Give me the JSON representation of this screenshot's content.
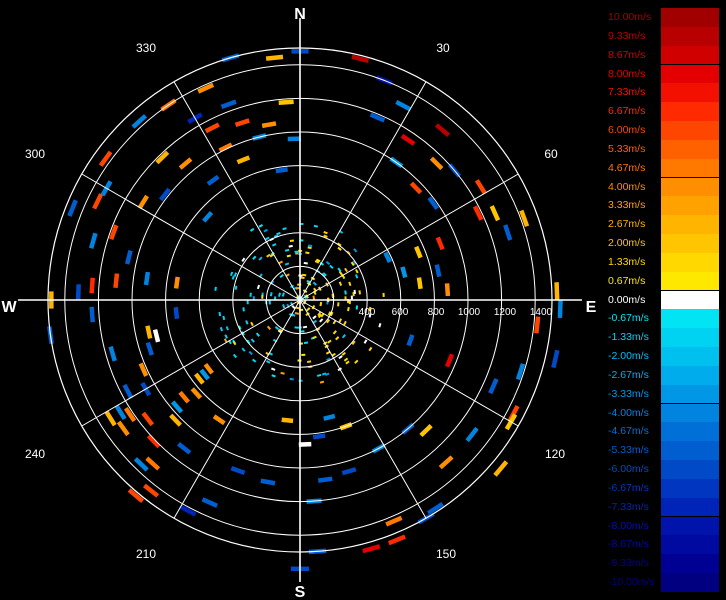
{
  "chart_data": {
    "type": "polar-scatter",
    "title": "",
    "directions": {
      "north": "N",
      "east": "E",
      "south": "S",
      "west": "W"
    },
    "angle_labels": [
      "30",
      "60",
      "120",
      "150",
      "210",
      "240",
      "300",
      "330"
    ],
    "range_labels": [
      "400",
      "600",
      "800",
      "1000",
      "1200",
      "1400"
    ],
    "range_max": 1500,
    "ring_step": 200,
    "legend": {
      "labels": [
        "10.00m/s",
        "9.33m/s",
        "8.67m/s",
        "8.00m/s",
        "7.33m/s",
        "6.67m/s",
        "6.00m/s",
        "5.33m/s",
        "4.67m/s",
        "4.00m/s",
        "3.33m/s",
        "2.67m/s",
        "2.00m/s",
        "1.33m/s",
        "0.67m/s",
        "0.00m/s",
        "-0.67m/s",
        "-1.33m/s",
        "-2.00m/s",
        "-2.67m/s",
        "-3.33m/s",
        "-4.00m/s",
        "-4.67m/s",
        "-5.33m/s",
        "-6.00m/s",
        "-6.67m/s",
        "-7.33m/s",
        "-8.00m/s",
        "-8.67m/s",
        "-9.33m/s",
        "-10.00m/s"
      ],
      "colors": [
        "#a00000",
        "#b80000",
        "#d00000",
        "#e40000",
        "#f41000",
        "#ff2a00",
        "#ff4600",
        "#ff6000",
        "#ff7800",
        "#ff8e00",
        "#ffa200",
        "#ffb400",
        "#ffc600",
        "#ffd800",
        "#ffe800",
        "#ffffff",
        "#00e4f4",
        "#00d2f2",
        "#00c0f0",
        "#00acec",
        "#0098e6",
        "#0084e0",
        "#0070d8",
        "#005ed0",
        "#004ac8",
        "#0036c0",
        "#0024b8",
        "#0014ac",
        "#000aa0",
        "#000092",
        "#000080"
      ]
    },
    "points": [
      {
        "az": 0,
        "r": 1480,
        "v": -6.0
      },
      {
        "az": 14,
        "r": 1480,
        "v": 9.0
      },
      {
        "az": 21,
        "r": 1400,
        "v": -8.0
      },
      {
        "az": 23,
        "r": 1180,
        "v": -5.0
      },
      {
        "az": 28,
        "r": 1310,
        "v": -4.0
      },
      {
        "az": 34,
        "r": 1150,
        "v": 8.0
      },
      {
        "az": 40,
        "r": 1320,
        "v": 9.0
      },
      {
        "az": 45,
        "r": 1150,
        "v": 4.0
      },
      {
        "az": 46,
        "r": 960,
        "v": 6.0
      },
      {
        "az": 50,
        "r": 1200,
        "v": -6.0
      },
      {
        "az": 35,
        "r": 1000,
        "v": -3.0
      },
      {
        "az": 58,
        "r": 1270,
        "v": 6.0
      },
      {
        "az": 54,
        "r": 980,
        "v": -5.0
      },
      {
        "az": 64,
        "r": 1180,
        "v": 7.0
      },
      {
        "az": 66,
        "r": 1270,
        "v": 2.0
      },
      {
        "az": 70,
        "r": 1420,
        "v": 2.5
      },
      {
        "az": 72,
        "r": 1300,
        "v": -5.0
      },
      {
        "az": 68,
        "r": 900,
        "v": 7.0
      },
      {
        "az": 68,
        "r": 760,
        "v": 2.0
      },
      {
        "az": 75,
        "r": 640,
        "v": -3.0
      },
      {
        "az": 64,
        "r": 580,
        "v": -4.0
      },
      {
        "az": 78,
        "r": 840,
        "v": -5.0
      },
      {
        "az": 82,
        "r": 720,
        "v": 2.0
      },
      {
        "az": 86,
        "r": 880,
        "v": 4.0
      },
      {
        "az": 88,
        "r": 1530,
        "v": 2.5
      },
      {
        "az": 92,
        "r": 1550,
        "v": -4.0
      },
      {
        "az": 96,
        "r": 1420,
        "v": 6.0
      },
      {
        "az": 103,
        "r": 1560,
        "v": -6.0
      },
      {
        "az": 108,
        "r": 1380,
        "v": -4.0
      },
      {
        "az": 114,
        "r": 1260,
        "v": -5.0
      },
      {
        "az": 118,
        "r": 1440,
        "v": 6.0
      },
      {
        "az": 112,
        "r": 960,
        "v": 8.0
      },
      {
        "az": 110,
        "r": 700,
        "v": -5.0
      },
      {
        "az": 120,
        "r": 1450,
        "v": 2.0
      },
      {
        "az": 130,
        "r": 1560,
        "v": 3.0
      },
      {
        "az": 128,
        "r": 1300,
        "v": -4.0
      },
      {
        "az": 136,
        "r": 1080,
        "v": 2.0
      },
      {
        "az": 138,
        "r": 1300,
        "v": 4.0
      },
      {
        "az": 147,
        "r": 1480,
        "v": -5.0
      },
      {
        "az": 150,
        "r": 1500,
        "v": -6.0
      },
      {
        "az": 157,
        "r": 1430,
        "v": 5.0
      },
      {
        "az": 158,
        "r": 1540,
        "v": 7.0
      },
      {
        "az": 164,
        "r": 1540,
        "v": 8.0
      },
      {
        "az": 140,
        "r": 1000,
        "v": -5.0
      },
      {
        "az": 152,
        "r": 1000,
        "v": -4.0
      },
      {
        "az": 160,
        "r": 800,
        "v": 2.0
      },
      {
        "az": 164,
        "r": 1060,
        "v": -6.0
      },
      {
        "az": 166,
        "r": 720,
        "v": -4.0
      },
      {
        "az": 172,
        "r": 820,
        "v": -6.0
      },
      {
        "az": 172,
        "r": 1080,
        "v": -5.0
      },
      {
        "az": 176,
        "r": 1500,
        "v": -5.0
      },
      {
        "az": 176,
        "r": 1200,
        "v": -4.0
      },
      {
        "az": 178,
        "r": 860,
        "v": 0.0
      },
      {
        "az": 180,
        "r": 1600,
        "v": -6.0
      },
      {
        "az": 186,
        "r": 720,
        "v": 3.0
      },
      {
        "az": 190,
        "r": 1100,
        "v": -5.0
      },
      {
        "az": 200,
        "r": 1080,
        "v": -6.0
      },
      {
        "az": 204,
        "r": 1320,
        "v": -5.0
      },
      {
        "az": 208,
        "r": 1420,
        "v": -7.0
      },
      {
        "az": 214,
        "r": 860,
        "v": 4.0
      },
      {
        "az": 218,
        "r": 1120,
        "v": -5.0
      },
      {
        "az": 218,
        "r": 1440,
        "v": 6.0
      },
      {
        "az": 220,
        "r": 1520,
        "v": 6.0
      },
      {
        "az": 222,
        "r": 1310,
        "v": 5.0
      },
      {
        "az": 224,
        "r": 1360,
        "v": -4.0
      },
      {
        "az": 226,
        "r": 1210,
        "v": 7.0
      },
      {
        "az": 226,
        "r": 1030,
        "v": 3.0
      },
      {
        "az": 229,
        "r": 970,
        "v": -3.0
      },
      {
        "az": 228,
        "r": 830,
        "v": 4.0
      },
      {
        "az": 230,
        "r": 900,
        "v": 5.0
      },
      {
        "az": 232,
        "r": 760,
        "v": 2.5
      },
      {
        "az": 232,
        "r": 720,
        "v": -3.0
      },
      {
        "az": 233,
        "r": 680,
        "v": 4.0
      },
      {
        "az": 232,
        "r": 1150,
        "v": 6.0
      },
      {
        "az": 234,
        "r": 1300,
        "v": 4.0
      },
      {
        "az": 236,
        "r": 1220,
        "v": 5.0
      },
      {
        "az": 238,
        "r": 1260,
        "v": -4.0
      },
      {
        "az": 238,
        "r": 1330,
        "v": 3.0
      },
      {
        "az": 240,
        "r": 1060,
        "v": -6.0
      },
      {
        "az": 242,
        "r": 1160,
        "v": -5.0
      },
      {
        "az": 246,
        "r": 1020,
        "v": 4.0
      },
      {
        "az": 252,
        "r": 940,
        "v": -5.0
      },
      {
        "az": 254,
        "r": 1160,
        "v": -4.0
      },
      {
        "az": 256,
        "r": 880,
        "v": 0.0
      },
      {
        "az": 258,
        "r": 920,
        "v": 3.0
      },
      {
        "az": 262,
        "r": 1500,
        "v": -5.0
      },
      {
        "az": 264,
        "r": 740,
        "v": -6.0
      },
      {
        "az": 266,
        "r": 1240,
        "v": -5.0
      },
      {
        "az": 270,
        "r": 1480,
        "v": 3.0
      },
      {
        "az": 272,
        "r": 1320,
        "v": -6.0
      },
      {
        "az": 274,
        "r": 1240,
        "v": 7.0
      },
      {
        "az": 276,
        "r": 1100,
        "v": 6.0
      },
      {
        "az": 278,
        "r": 920,
        "v": -4.0
      },
      {
        "az": 278,
        "r": 740,
        "v": 4.0
      },
      {
        "az": 284,
        "r": 1050,
        "v": -5.0
      },
      {
        "az": 286,
        "r": 1280,
        "v": -4.0
      },
      {
        "az": 290,
        "r": 1180,
        "v": 6.0
      },
      {
        "az": 292,
        "r": 1460,
        "v": -5.0
      },
      {
        "az": 296,
        "r": 1340,
        "v": 6.0
      },
      {
        "az": 300,
        "r": 1330,
        "v": -4.0
      },
      {
        "az": 302,
        "r": 1100,
        "v": 4.0
      },
      {
        "az": 306,
        "r": 1430,
        "v": 6.0
      },
      {
        "az": 308,
        "r": 1020,
        "v": -6.0
      },
      {
        "az": 312,
        "r": 740,
        "v": -4.0
      },
      {
        "az": 316,
        "r": 1180,
        "v": 3.0
      },
      {
        "az": 318,
        "r": 1430,
        "v": -4.0
      },
      {
        "az": 320,
        "r": 1060,
        "v": 4.0
      },
      {
        "az": 324,
        "r": 880,
        "v": -5.0
      },
      {
        "az": 326,
        "r": 1400,
        "v": 5.0
      },
      {
        "az": 330,
        "r": 1250,
        "v": -7.0
      },
      {
        "az": 333,
        "r": 1150,
        "v": 6.0
      },
      {
        "az": 334,
        "r": 1010,
        "v": 5.0
      },
      {
        "az": 336,
        "r": 1380,
        "v": 4.0
      },
      {
        "az": 338,
        "r": 900,
        "v": 3.0
      },
      {
        "az": 340,
        "r": 1240,
        "v": -5.0
      },
      {
        "az": 342,
        "r": 1110,
        "v": 6.0
      },
      {
        "az": 344,
        "r": 1500,
        "v": -5.0
      },
      {
        "az": 346,
        "r": 1000,
        "v": -4.0
      },
      {
        "az": 350,
        "r": 1060,
        "v": 4.0
      },
      {
        "az": 352,
        "r": 780,
        "v": -5.0
      },
      {
        "az": 354,
        "r": 1450,
        "v": 3.0
      },
      {
        "az": 356,
        "r": 1180,
        "v": 2.0
      },
      {
        "az": 358,
        "r": 960,
        "v": -4.0
      }
    ]
  }
}
